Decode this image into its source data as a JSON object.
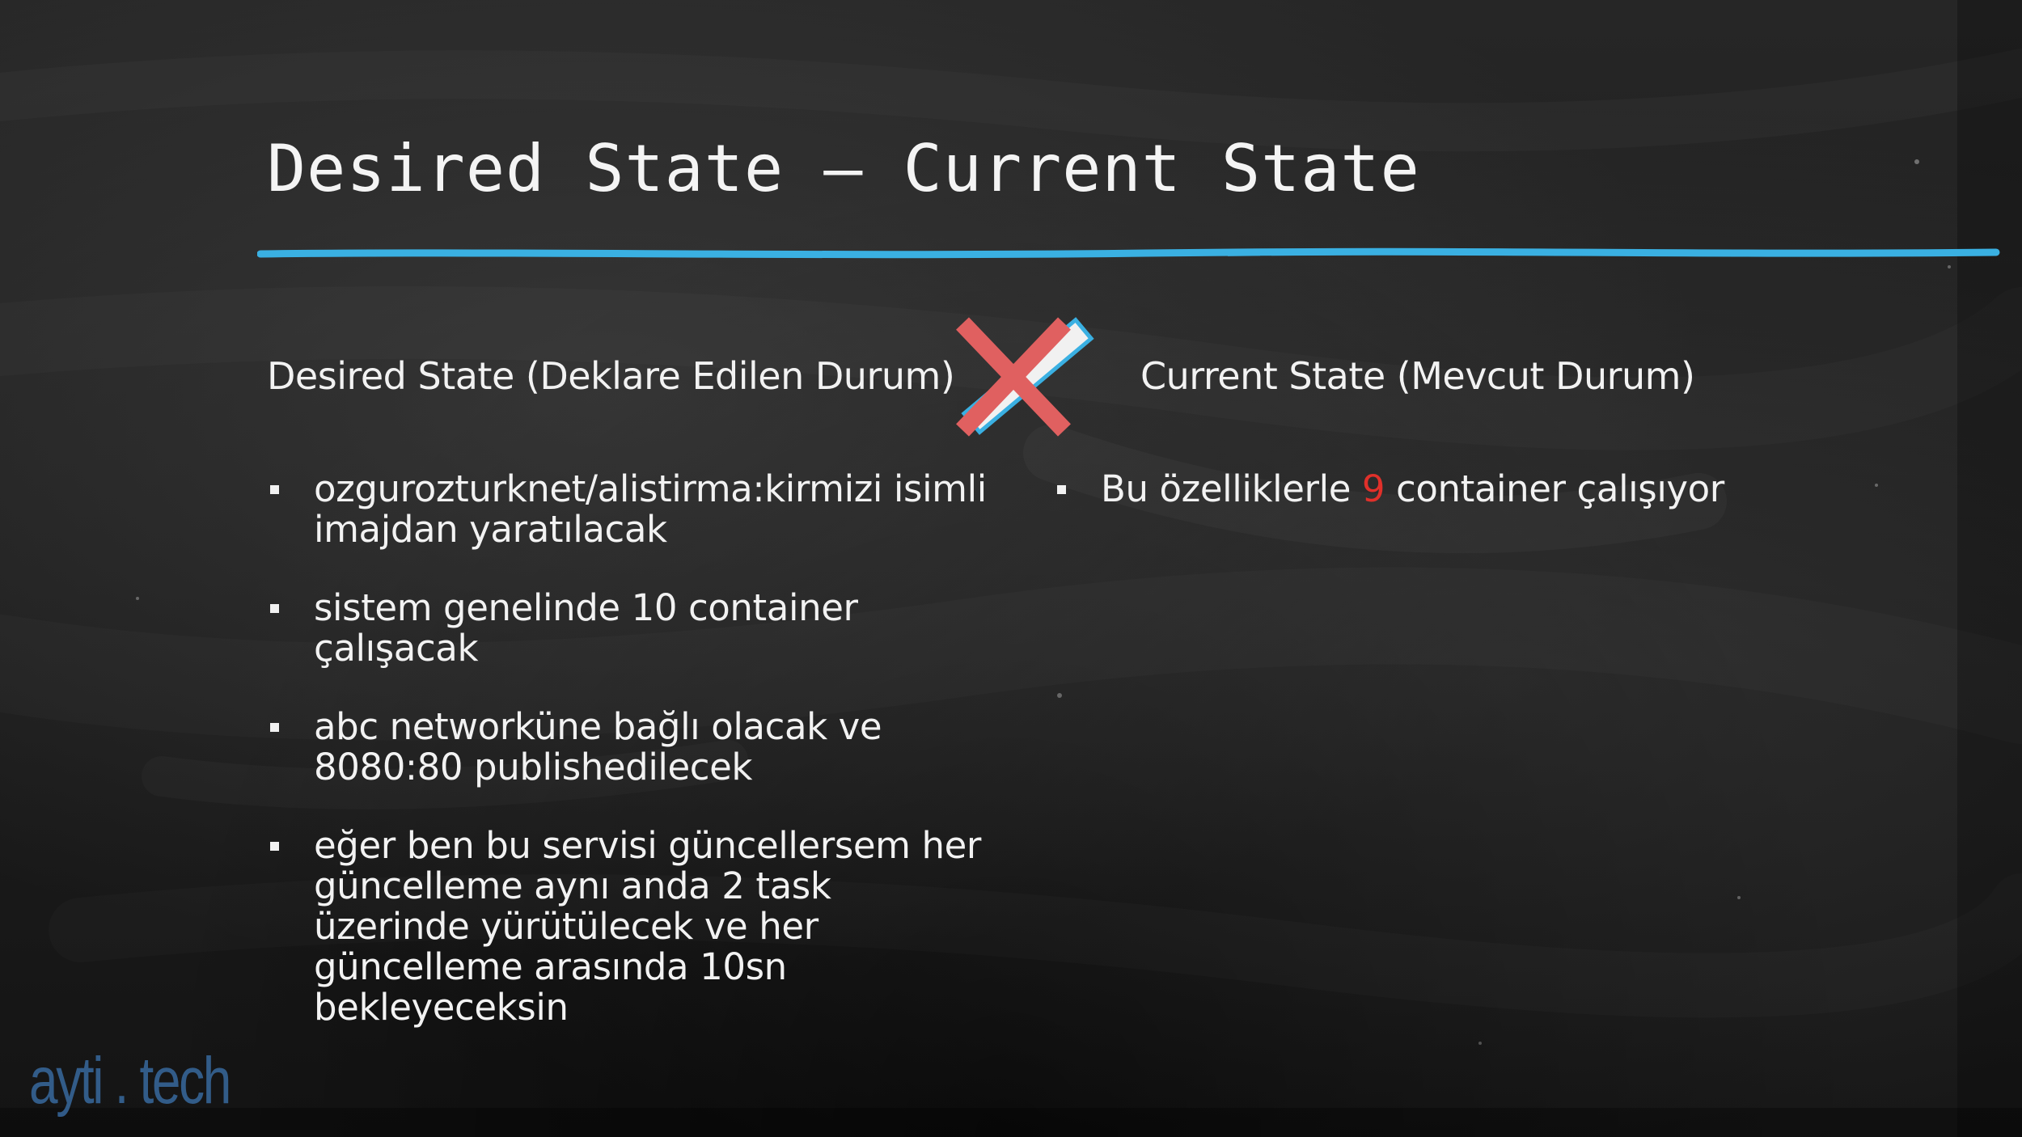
{
  "slide": {
    "title": "Desired State – Current State",
    "accent_color": "#3ab0e2",
    "desired": {
      "heading": "Desired State (Deklare Edilen Durum)",
      "bullets": [
        "ozgurozturknet/alistirma:kirmizi isimli imajdan yaratılacak",
        "sistem genelinde 10 container çalışacak",
        "abc networküne bağlı olacak ve 8080:80 publishedilecek",
        "eğer ben bu servisi güncellersem her güncelleme aynı anda 2 task üzerinde yürütülecek ve her güncelleme arasında 10sn bekleyeceksin"
      ]
    },
    "current": {
      "heading": "Current State (Mevcut Durum)",
      "bullet_prefix": "Bu özelliklerle ",
      "bullet_count": "9",
      "bullet_suffix": " container çalışıyor",
      "highlight_color": "#e0302a"
    },
    "icons": {
      "mismatch": "x-mark-icon",
      "bullet": "square-bullet-icon"
    },
    "logo": "ayti . tech"
  }
}
